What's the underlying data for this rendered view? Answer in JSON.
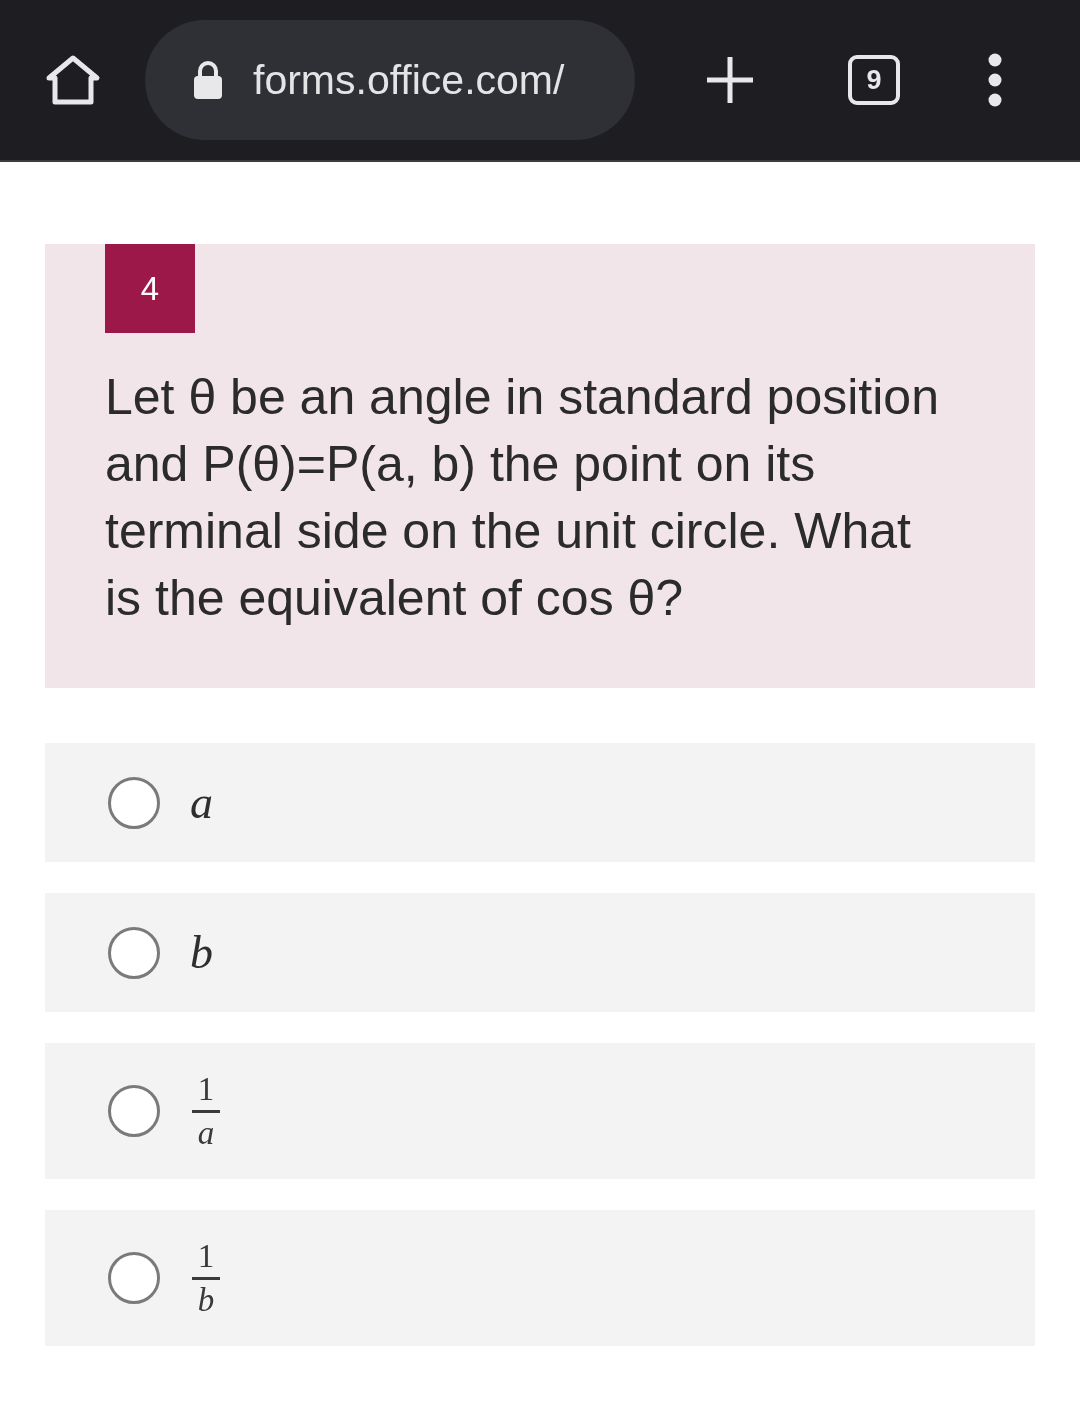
{
  "browser": {
    "url": "forms.office.com/",
    "tab_count": "9"
  },
  "question": {
    "number": "4",
    "text": "Let θ be an angle in standard position and P(θ)=P(a, b) the point on its terminal side on the unit circle. What is the equivalent of cos θ?"
  },
  "options": [
    {
      "kind": "variable",
      "label": "a",
      "selected": false
    },
    {
      "kind": "variable",
      "label": "b",
      "selected": false
    },
    {
      "kind": "fraction",
      "numerator": "1",
      "denominator": "a",
      "selected": false
    },
    {
      "kind": "fraction",
      "numerator": "1",
      "denominator": "b",
      "selected": false
    }
  ]
}
